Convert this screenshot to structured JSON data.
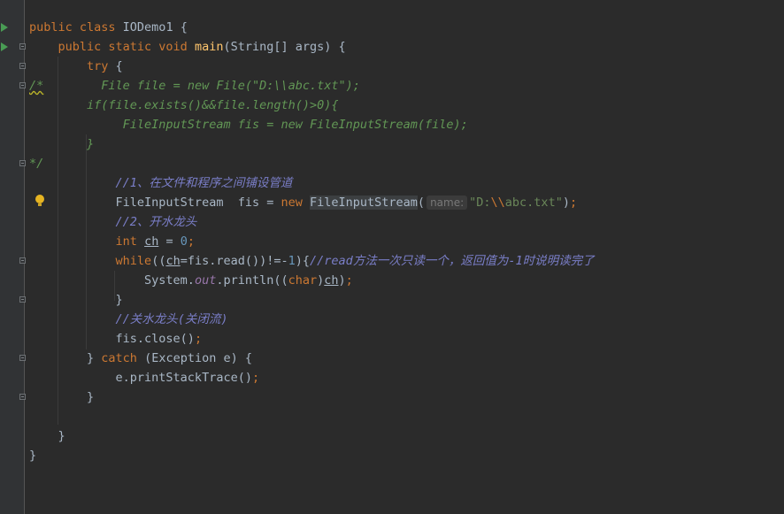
{
  "editor": {
    "language": "java",
    "lines": [
      {
        "tokens": [
          {
            "t": "public class ",
            "c": "kw"
          },
          {
            "t": "IODemo1 {"
          }
        ]
      },
      {
        "tokens": [
          {
            "t": "    "
          },
          {
            "t": "public static void ",
            "c": "kw"
          },
          {
            "t": "main",
            "c": "fn"
          },
          {
            "t": "(String[] args) {"
          }
        ]
      },
      {
        "tokens": [
          {
            "t": "        "
          },
          {
            "t": "try ",
            "c": "kw"
          },
          {
            "t": "{"
          }
        ]
      },
      {
        "tokens": [
          {
            "t": "/*",
            "c": "cmt warn"
          },
          {
            "t": "        File file = new File(\"D:\\\\abc.txt\");",
            "c": "cmt"
          }
        ]
      },
      {
        "tokens": [
          {
            "t": "        if(file.exists()&&file.length()>0){",
            "c": "cmt"
          }
        ]
      },
      {
        "tokens": [
          {
            "t": "             FileInputStream fis = new FileInputStream(file);",
            "c": "cmt"
          }
        ]
      },
      {
        "tokens": [
          {
            "t": "        }",
            "c": "cmt"
          }
        ]
      },
      {
        "tokens": [
          {
            "t": "*/",
            "c": "cmt"
          }
        ]
      },
      {
        "tokens": [
          {
            "t": "            "
          },
          {
            "t": "//1、在文件和程序之间铺设管道",
            "c": "doc"
          }
        ]
      },
      {
        "tokens": [
          {
            "t": "            FileInputStream  fis = "
          },
          {
            "t": "new ",
            "c": "kw"
          },
          {
            "t": "FileInputStream",
            "c": "hl"
          },
          {
            "t": "("
          },
          {
            "hint": "name:"
          },
          {
            "t": "\"D:",
            "c": "str"
          },
          {
            "t": "\\\\",
            "c": "kw"
          },
          {
            "t": "abc.txt\"",
            "c": "str"
          },
          {
            "t": ")"
          },
          {
            "t": ";",
            "c": "kw"
          }
        ]
      },
      {
        "tokens": [
          {
            "t": "            "
          },
          {
            "t": "//2、开水龙头",
            "c": "doc"
          }
        ]
      },
      {
        "tokens": [
          {
            "t": "            "
          },
          {
            "t": "int ",
            "c": "kw"
          },
          {
            "t": "ch",
            "c": "ul"
          },
          {
            "t": " = "
          },
          {
            "t": "0",
            "c": "num"
          },
          {
            "t": ";",
            "c": "kw"
          }
        ]
      },
      {
        "tokens": [
          {
            "t": "            "
          },
          {
            "t": "while",
            "c": "kw"
          },
          {
            "t": "(("
          },
          {
            "t": "ch",
            "c": "ul"
          },
          {
            "t": "=fis.read())!=-"
          },
          {
            "t": "1",
            "c": "num"
          },
          {
            "t": "){"
          },
          {
            "t": "//read方法一次只读一个，返回值为-1时说明读完了",
            "c": "doc"
          }
        ]
      },
      {
        "tokens": [
          {
            "t": "                System."
          },
          {
            "t": "out",
            "c": "field"
          },
          {
            "t": ".println(("
          },
          {
            "t": "char",
            "c": "kw"
          },
          {
            "t": ")"
          },
          {
            "t": "ch",
            "c": "ul"
          },
          {
            "t": ")"
          },
          {
            "t": ";",
            "c": "kw"
          }
        ]
      },
      {
        "tokens": [
          {
            "t": "            }"
          }
        ]
      },
      {
        "tokens": [
          {
            "t": "            "
          },
          {
            "t": "//关水龙头(关闭流)",
            "c": "doc"
          }
        ]
      },
      {
        "tokens": [
          {
            "t": "            fis.close()"
          },
          {
            "t": ";",
            "c": "kw"
          }
        ]
      },
      {
        "tokens": [
          {
            "t": "        } "
          },
          {
            "t": "catch ",
            "c": "kw"
          },
          {
            "t": "(Exception e) {"
          }
        ]
      },
      {
        "tokens": [
          {
            "t": "            e.printStackTrace()"
          },
          {
            "t": ";",
            "c": "kw"
          }
        ]
      },
      {
        "tokens": [
          {
            "t": "        }"
          }
        ]
      },
      {
        "tokens": [
          {
            "t": ""
          }
        ]
      },
      {
        "tokens": [
          {
            "t": "    }"
          }
        ]
      },
      {
        "tokens": [
          {
            "t": "}"
          }
        ]
      }
    ]
  },
  "gutter": {
    "run_lines": [
      0,
      1
    ],
    "fold_lines": [
      1,
      2,
      3,
      7,
      12,
      14,
      17,
      19
    ],
    "bulb_line": 9
  },
  "colors": {
    "background": "#2b2b2b",
    "gutter": "#313335",
    "keyword": "#cc7832",
    "string": "#6a8759",
    "number": "#6897bb",
    "comment": "#629755",
    "doc_comment": "#7a7ec8",
    "method": "#ffc66d",
    "field": "#9876aa"
  }
}
